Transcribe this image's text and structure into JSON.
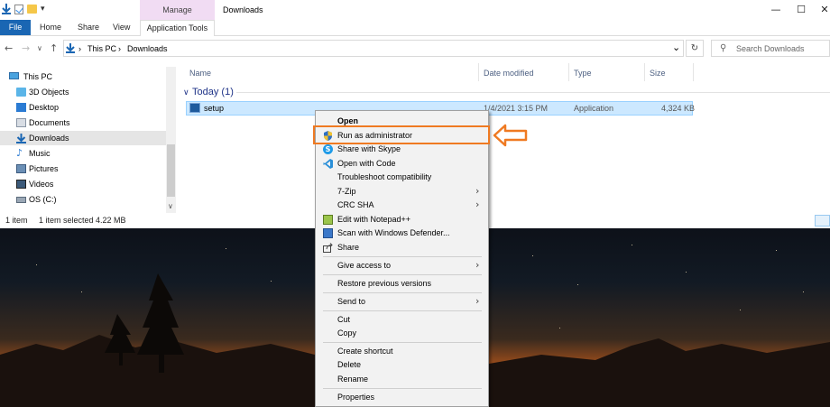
{
  "window": {
    "title": "Downloads",
    "manage_label": "Manage",
    "controls": {
      "minimize": "—",
      "maximize": "☐",
      "close": "✕"
    }
  },
  "ribbon": {
    "file": "File",
    "home": "Home",
    "share": "Share",
    "view": "View",
    "app_tools": "Application Tools"
  },
  "address": {
    "crumb1": "This PC",
    "sep": "›",
    "crumb2": "Downloads",
    "dropdown": "⌄",
    "refresh": "↻"
  },
  "search": {
    "placeholder": "Search Downloads"
  },
  "navpane": {
    "items": [
      {
        "label": "This PC"
      },
      {
        "label": "3D Objects"
      },
      {
        "label": "Desktop"
      },
      {
        "label": "Documents"
      },
      {
        "label": "Downloads",
        "selected": true
      },
      {
        "label": "Music"
      },
      {
        "label": "Pictures"
      },
      {
        "label": "Videos"
      },
      {
        "label": "OS (C:)"
      }
    ]
  },
  "columns": {
    "name": "Name",
    "date": "Date modified",
    "type": "Type",
    "size": "Size"
  },
  "group": {
    "label": "Today (1)"
  },
  "file": {
    "name": "setup",
    "date": "1/4/2021 3:15 PM",
    "type": "Application",
    "size": "4,324 KB"
  },
  "status": {
    "count": "1 item",
    "selection": "1 item selected  4.22 MB"
  },
  "context_menu": {
    "items": [
      {
        "label": "Open",
        "bold": true
      },
      {
        "label": "Run as administrator",
        "icon": "shield-icon"
      },
      {
        "label": "Share with Skype",
        "icon": "skype-icon"
      },
      {
        "label": "Open with Code",
        "icon": "vscode-icon"
      },
      {
        "label": "Troubleshoot compatibility"
      },
      {
        "label": "7-Zip",
        "submenu": true
      },
      {
        "label": "CRC SHA",
        "submenu": true
      },
      {
        "label": "Edit with Notepad++",
        "icon": "notepadpp-icon"
      },
      {
        "label": "Scan with Windows Defender...",
        "icon": "defender-icon"
      },
      {
        "label": "Share",
        "icon": "share-icon"
      },
      {
        "label": "Give access to",
        "submenu": true
      },
      {
        "label": "Restore previous versions"
      },
      {
        "label": "Send to",
        "submenu": true
      },
      {
        "label": "Cut"
      },
      {
        "label": "Copy"
      },
      {
        "label": "Create shortcut"
      },
      {
        "label": "Delete"
      },
      {
        "label": "Rename"
      },
      {
        "label": "Properties"
      }
    ],
    "submenu_glyph": "›"
  },
  "colors": {
    "highlight": "#ef7a22",
    "selection": "#cce8ff",
    "accent": "#1a66b3"
  }
}
